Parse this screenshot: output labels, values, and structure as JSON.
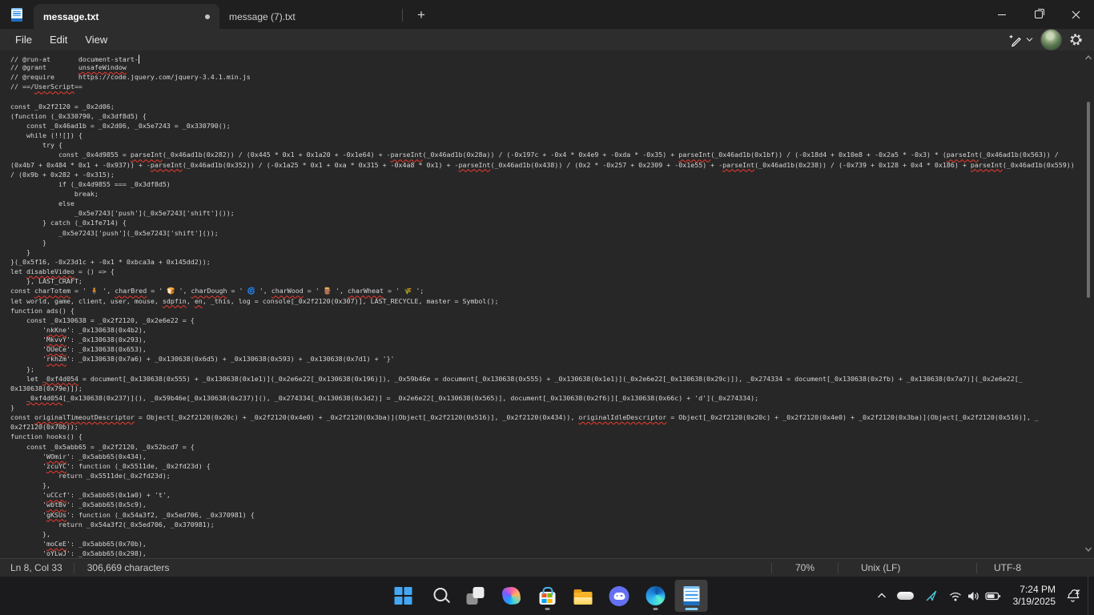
{
  "window": {
    "app_name": "Notepad",
    "tabs": [
      {
        "label": "message.txt",
        "modified": true,
        "active": true
      },
      {
        "label": "message (7).txt",
        "modified": false,
        "active": false
      }
    ],
    "new_tab_label": "+"
  },
  "menu": {
    "items": [
      {
        "label": "File"
      },
      {
        "label": "Edit"
      },
      {
        "label": "View"
      }
    ]
  },
  "editor": {
    "caret": {
      "line_index": 0
    },
    "squiggle_words": [
      "unsafeWindow",
      "UserScript",
      "parseInt",
      "disableVideo",
      "charTotem",
      "charBred",
      "charDough",
      "charWood",
      "charWheat",
      "sdpfin",
      "en",
      "nkKne",
      "MkvvY",
      "OUeCe",
      "rkhZm",
      "_0xf4d054",
      "originalTimeoutDescriptor",
      "originalIdleDescriptor",
      "WOmir",
      "zcuYC",
      "uCCcf",
      "wbtBv",
      "gKSUs",
      "moCeE",
      "oYLwJ"
    ],
    "lines": [
      "// @run-at       document-start-",
      "// @grant        unsafeWindow",
      "// @require      https://code.jquery.com/jquery-3.4.1.min.js",
      "// ==/UserScript==",
      "",
      "const _0x2f2120 = _0x2d06;",
      "(function (_0x330790, _0x3df8d5) {",
      "    const _0x46ad1b = _0x2d06, _0x5e7243 = _0x330790();",
      "    while (!![]) {",
      "        try {",
      "            const _0x4d9855 = parseInt(_0x46ad1b(0x282)) / (0x445 * 0x1 + 0x1a20 + -0x1e64) + -parseInt(_0x46ad1b(0x28a)) / (-0x197c + -0x4 * 0x4e9 + -0xda * -0x35) + parseInt(_0x46ad1b(0x1bf)) / (-0x18d4 + 0x10e8 + -0x2a5 * -0x3) * (parseInt(_0x46ad1b(0x563)) /",
      "(0x4b7 + 0x484 * 0x1 + -0x937)) + -parseInt(_0x46ad1b(0x352)) / (-0x1a25 * 0x1 + 0xa * 0x315 + -0x4a8 * 0x1) + -parseInt(_0x46ad1b(0x438)) / (0x2 * -0x257 + 0x2309 + -0x1e55) + -parseInt(_0x46ad1b(0x238)) / (-0x739 + 0x128 + 0x4 * 0x186) + parseInt(_0x46ad1b(0x559))",
      "/ (0x9b + 0x282 + -0x315);",
      "            if (_0x4d9855 === _0x3df8d5)",
      "                break;",
      "            else",
      "                _0x5e7243['push'](_0x5e7243['shift']());",
      "        } catch (_0x1fe714) {",
      "            _0x5e7243['push'](_0x5e7243['shift']());",
      "        }",
      "    }",
      "}(_0x5f16, -0x23d1c + -0x1 * 0xbca3a + 0x145dd2));",
      "let disableVideo = () => {",
      "    }, LAST_CRAFT;",
      "const charTotem = ' 🧍 ', charBred = ' 🍞 ', charDough = ' 🌀 ', charWood = ' 🪵 ', charWheat = ' 🌾 ';",
      "let world, game, client, user, mouse, sdpfin, en, _this, log = console[_0x2f2120(0x307)], LAST_RECYCLE, master = Symbol();",
      "function ads() {",
      "    const _0x130638 = _0x2f2120, _0x2e6e22 = {",
      "        'nkKne': _0x130638(0x4b2),",
      "        'MkvvY': _0x130638(0x293),",
      "        'OUeCe': _0x130638(0x653),",
      "        'rkhZm': _0x130638(0x7a6) + _0x130638(0x6d5) + _0x130638(0x593) + _0x130638(0x7d1) + '}'",
      "    };",
      "    let _0xf4d054 = document[_0x130638(0x555) + _0x130638(0x1e1)](_0x2e6e22[_0x130638(0x196)]), _0x59b46e = document[_0x130638(0x555) + _0x130638(0x1e1)](_0x2e6e22[_0x130638(0x29c)]), _0x274334 = document[_0x130638(0x2fb) + _0x130638(0x7a7)](_0x2e6e22[_",
      "0x130638(0x79e)]);",
      "    _0xf4d054[_0x130638(0x237)](), _0x59b46e[_0x130638(0x237)](), _0x274334[_0x130638(0x3d2)] = _0x2e6e22[_0x130638(0x565)], document[_0x130638(0x2f6)][_0x130638(0x66c) + 'd'](_0x274334);",
      "}",
      "const originalTimeoutDescriptor = Object[_0x2f2120(0x20c) + _0x2f2120(0x4e0) + _0x2f2120(0x3ba)](Object[_0x2f2120(0x516)], _0x2f2120(0x434)), originalIdleDescriptor = Object[_0x2f2120(0x20c) + _0x2f2120(0x4e0) + _0x2f2120(0x3ba)](Object[_0x2f2120(0x516)], _",
      "0x2f2120(0x70b));",
      "function hooks() {",
      "    const _0x5abb65 = _0x2f2120, _0x52bcd7 = {",
      "        'WOmir': _0x5abb65(0x434),",
      "        'zcuYC': function (_0x5511de, _0x2fd23d) {",
      "            return _0x5511de(_0x2fd23d);",
      "        },",
      "        'uCCcf': _0x5abb65(0x1a0) + 't',",
      "        'wbtBv': _0x5abb65(0x5c9),",
      "        'gKSUs': function (_0x54a3f2, _0x5ed706, _0x370981) {",
      "            return _0x54a3f2(_0x5ed706, _0x370981);",
      "        },",
      "        'moCeE': _0x5abb65(0x70b),",
      "        'oYLwJ': _0x5abb65(0x298),"
    ]
  },
  "status_bar": {
    "cursor_position": "Ln 8, Col 33",
    "character_count": "306,669 characters",
    "zoom_level": "70%",
    "line_ending": "Unix (LF)",
    "encoding": "UTF-8"
  },
  "taskbar": {
    "items": [
      {
        "name": "start"
      },
      {
        "name": "search"
      },
      {
        "name": "task-view"
      },
      {
        "name": "copilot"
      },
      {
        "name": "microsoft-store",
        "running": true
      },
      {
        "name": "file-explorer"
      },
      {
        "name": "discord"
      },
      {
        "name": "edge",
        "running": true
      },
      {
        "name": "notepad",
        "active": true
      }
    ],
    "tray": {
      "time": "7:24 PM",
      "date": "3/19/2025",
      "icons": [
        "hidden-icons-chevron",
        "onedrive",
        "location-arrow",
        "wifi",
        "volume",
        "battery",
        "notification-bell"
      ]
    }
  },
  "colors": {
    "accent": "#85cdff",
    "squiggle": "#f03a2e",
    "editor_bg": "#272727",
    "surface": "#2d2d2d",
    "taskbar_bg": "#1b1b1d"
  }
}
